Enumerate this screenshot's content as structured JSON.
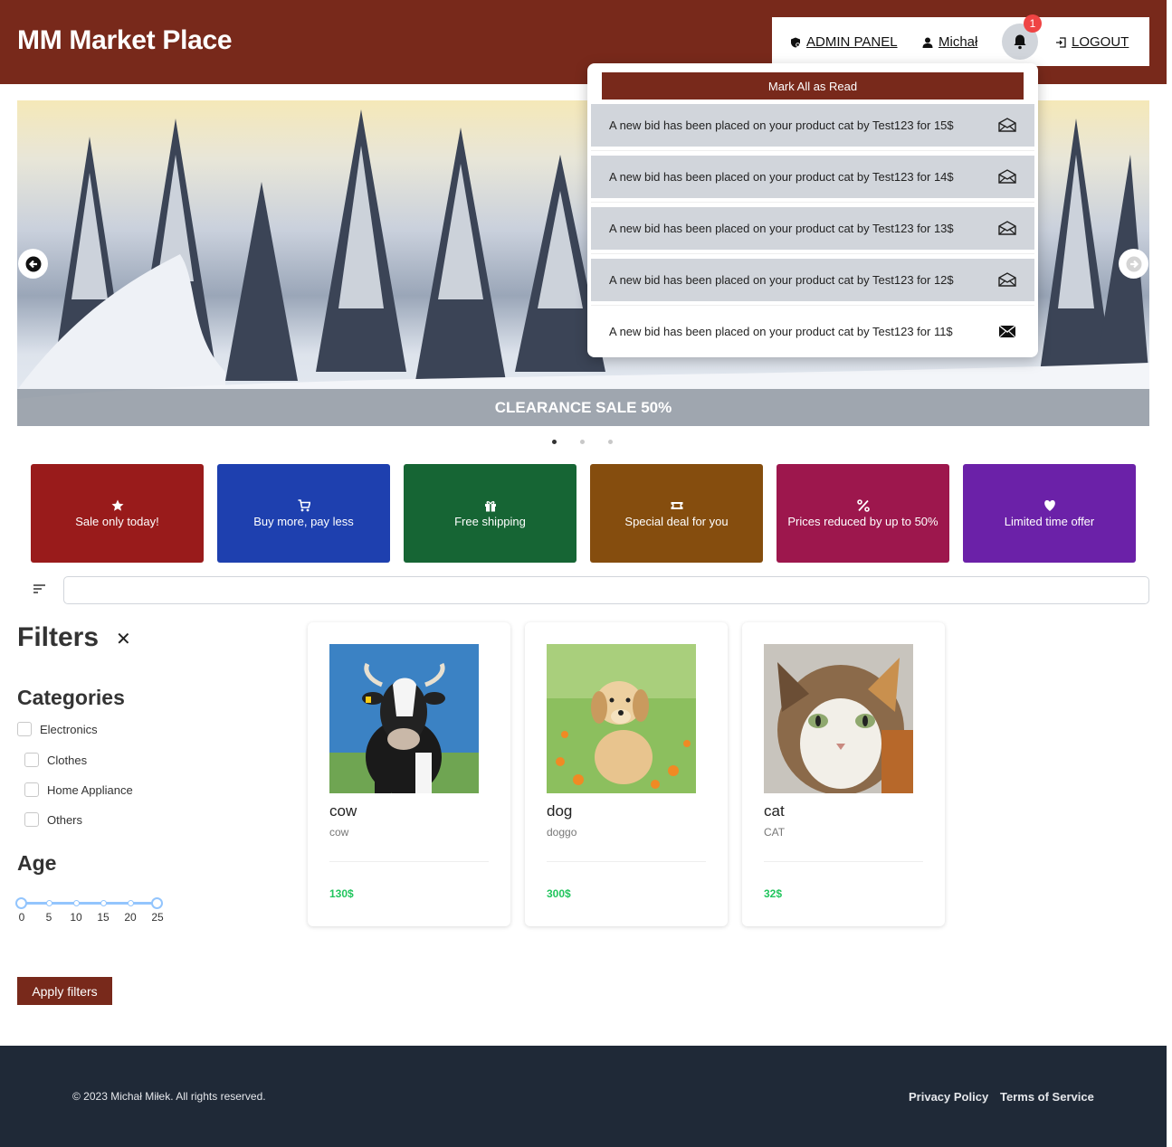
{
  "header": {
    "brand": "MM Market Place",
    "admin_label": "ADMIN PANEL",
    "user_label": "Michał",
    "logout_label": "LOGOUT",
    "notification_count": "1"
  },
  "notifications": {
    "mark_all_label": "Mark All as Read",
    "items": [
      {
        "text": "A new bid has been placed on your product cat by Test123 for 15$",
        "read": false
      },
      {
        "text": "A new bid has been placed on your product cat by Test123 for 14$",
        "read": false
      },
      {
        "text": "A new bid has been placed on your product cat by Test123 for 13$",
        "read": false
      },
      {
        "text": "A new bid has been placed on your product cat by Test123 for 12$",
        "read": false
      },
      {
        "text": "A new bid has been placed on your product cat by Test123 for 11$",
        "read": true
      }
    ]
  },
  "carousel": {
    "caption": "CLEARANCE SALE 50%",
    "slide_count": 3,
    "active_slide": 1
  },
  "promos": [
    {
      "label": "Sale only today!",
      "icon": "star-icon",
      "color": "#991b1b"
    },
    {
      "label": "Buy more, pay less",
      "icon": "cart-icon",
      "color": "#1e40af"
    },
    {
      "label": "Free shipping",
      "icon": "gift-icon",
      "color": "#166534"
    },
    {
      "label": "Special deal for you",
      "icon": "ticket-icon",
      "color": "#854d0e"
    },
    {
      "label": "Prices reduced by up to 50%",
      "icon": "percent-icon",
      "color": "#9d174d"
    },
    {
      "label": "Limited time offer",
      "icon": "heart-icon",
      "color": "#6b21a8"
    }
  ],
  "search": {
    "placeholder": ""
  },
  "filters": {
    "title": "Filters",
    "categories_title": "Categories",
    "categories": [
      "Electronics",
      "Clothes",
      "Home Appliance",
      "Others"
    ],
    "age_title": "Age",
    "age_ticks": [
      "0",
      "5",
      "10",
      "15",
      "20",
      "25"
    ],
    "age_range": [
      0,
      25
    ],
    "apply_label": "Apply filters"
  },
  "products": [
    {
      "title": "cow",
      "subtitle": "cow",
      "price": "130$",
      "image": "cow-photo"
    },
    {
      "title": "dog",
      "subtitle": "doggo",
      "price": "300$",
      "image": "dog-photo"
    },
    {
      "title": "cat",
      "subtitle": "CAT",
      "price": "32$",
      "image": "cat-photo"
    }
  ],
  "footer": {
    "copyright": "© 2023 Michał Miłek. All rights reserved.",
    "privacy_label": "Privacy Policy",
    "terms_label": "Terms of Service"
  }
}
